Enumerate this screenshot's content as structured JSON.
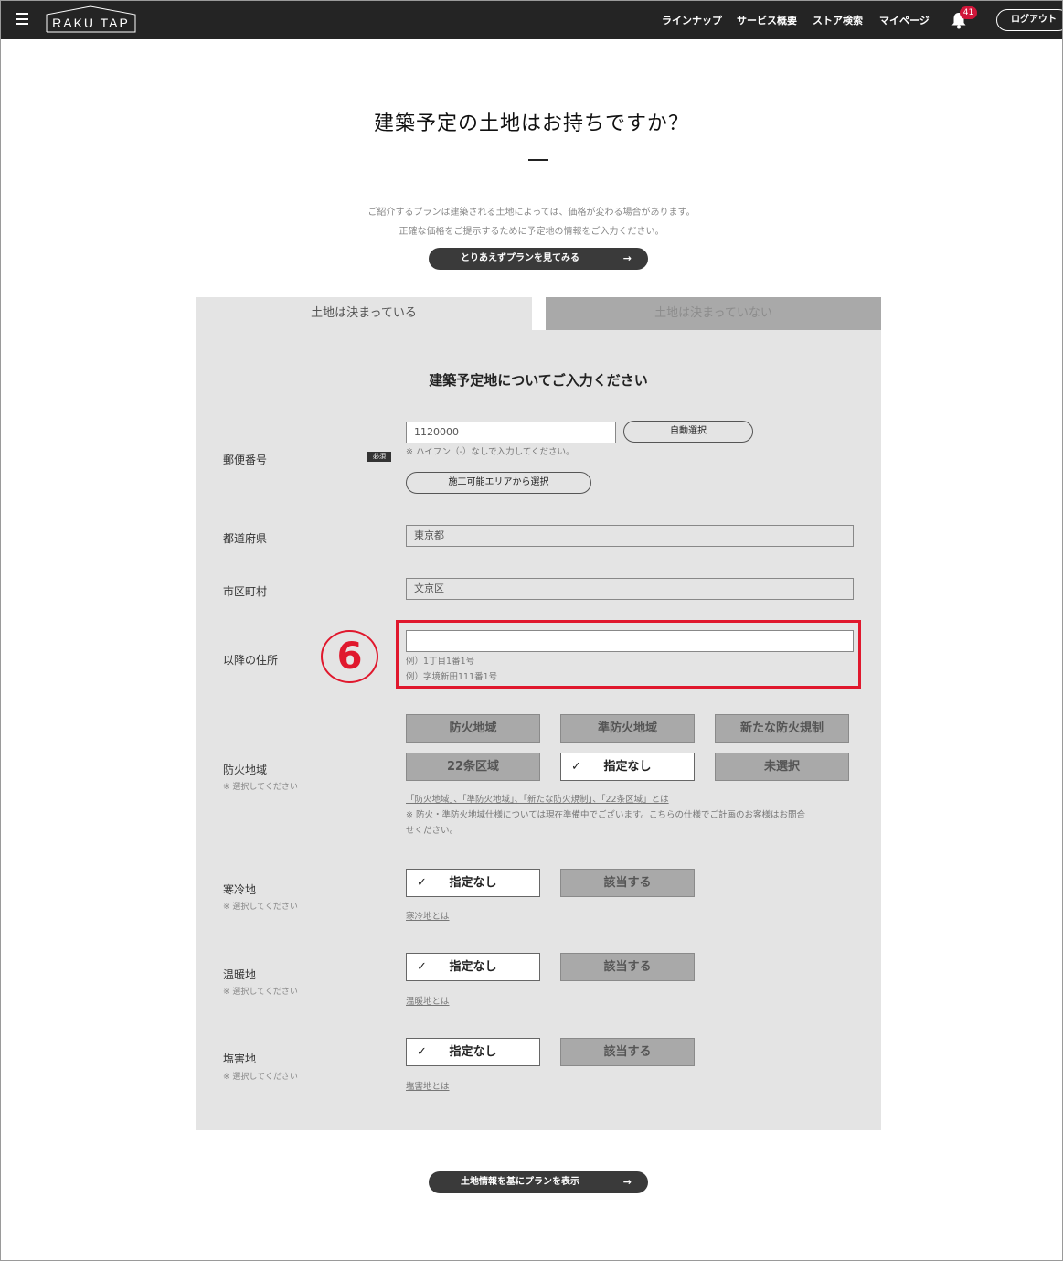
{
  "header": {
    "logo": "RAKU TAP",
    "nav": [
      "ラインナップ",
      "サービス概要",
      "ストア検索",
      "マイページ"
    ],
    "notification_count": "41",
    "logout_label": "ログアウト"
  },
  "page": {
    "title": "建築予定の土地はお持ちですか？",
    "intro_line1": "ご紹介するプランは建築される土地によっては、価格が変わる場合があります。",
    "intro_line2": "正確な価格をご提示するために予定地の情報をご入力ください。",
    "see_plans_button": "とりあえずプランを見てみる",
    "arrow": "→"
  },
  "tabs": {
    "decided": "土地は決まっている",
    "not_decided": "土地は決まっていない"
  },
  "form": {
    "section_title": "建築予定地についてご入力ください",
    "postal": {
      "label": "郵便番号",
      "required_badge": "必須",
      "value": "1120000",
      "auto_select_button": "自動選択",
      "hint": "※ ハイフン（-）なしで入力してください。",
      "area_button": "施工可能エリアから選択"
    },
    "prefecture": {
      "label": "都道府県",
      "value": "東京都"
    },
    "city": {
      "label": "市区町村",
      "value": "文京区"
    },
    "address": {
      "label": "以降の住所",
      "value": "",
      "example1": "例）1丁目1番1号",
      "example2": "例）字境新田111番1号"
    },
    "annotation_number": "6",
    "fire_zone": {
      "label": "防火地域",
      "sublabel": "※ 選択してください",
      "options": [
        "防火地域",
        "準防火地域",
        "新たな防火規制",
        "22条区域",
        "指定なし",
        "未選択"
      ],
      "selected": "指定なし",
      "check": "✓",
      "link": "「防火地域」、「準防火地域」、「新たな防火規制」、「22条区域」とは",
      "note_line1": "※ 防火・準防火地域仕様については現在準備中でございます。こちらの仕様でご計画のお客様はお問合",
      "note_line2": "せください。"
    },
    "cold": {
      "label": "寒冷地",
      "sublabel": "※ 選択してください",
      "option_none": "指定なし",
      "option_yes": "該当する",
      "link": "寒冷地とは"
    },
    "warm": {
      "label": "温暖地",
      "sublabel": "※ 選択してください",
      "option_none": "指定なし",
      "option_yes": "該当する",
      "link": "温暖地とは"
    },
    "salt": {
      "label": "塩害地",
      "sublabel": "※ 選択してください",
      "option_none": "指定なし",
      "option_yes": "該当する",
      "link": "塩害地とは"
    },
    "submit_button": "土地情報を基にプランを表示"
  },
  "colors": {
    "header_bg": "#242424",
    "highlight": "#e0182d",
    "badge": "#d0163a",
    "panel_bg": "#e4e4e4"
  }
}
